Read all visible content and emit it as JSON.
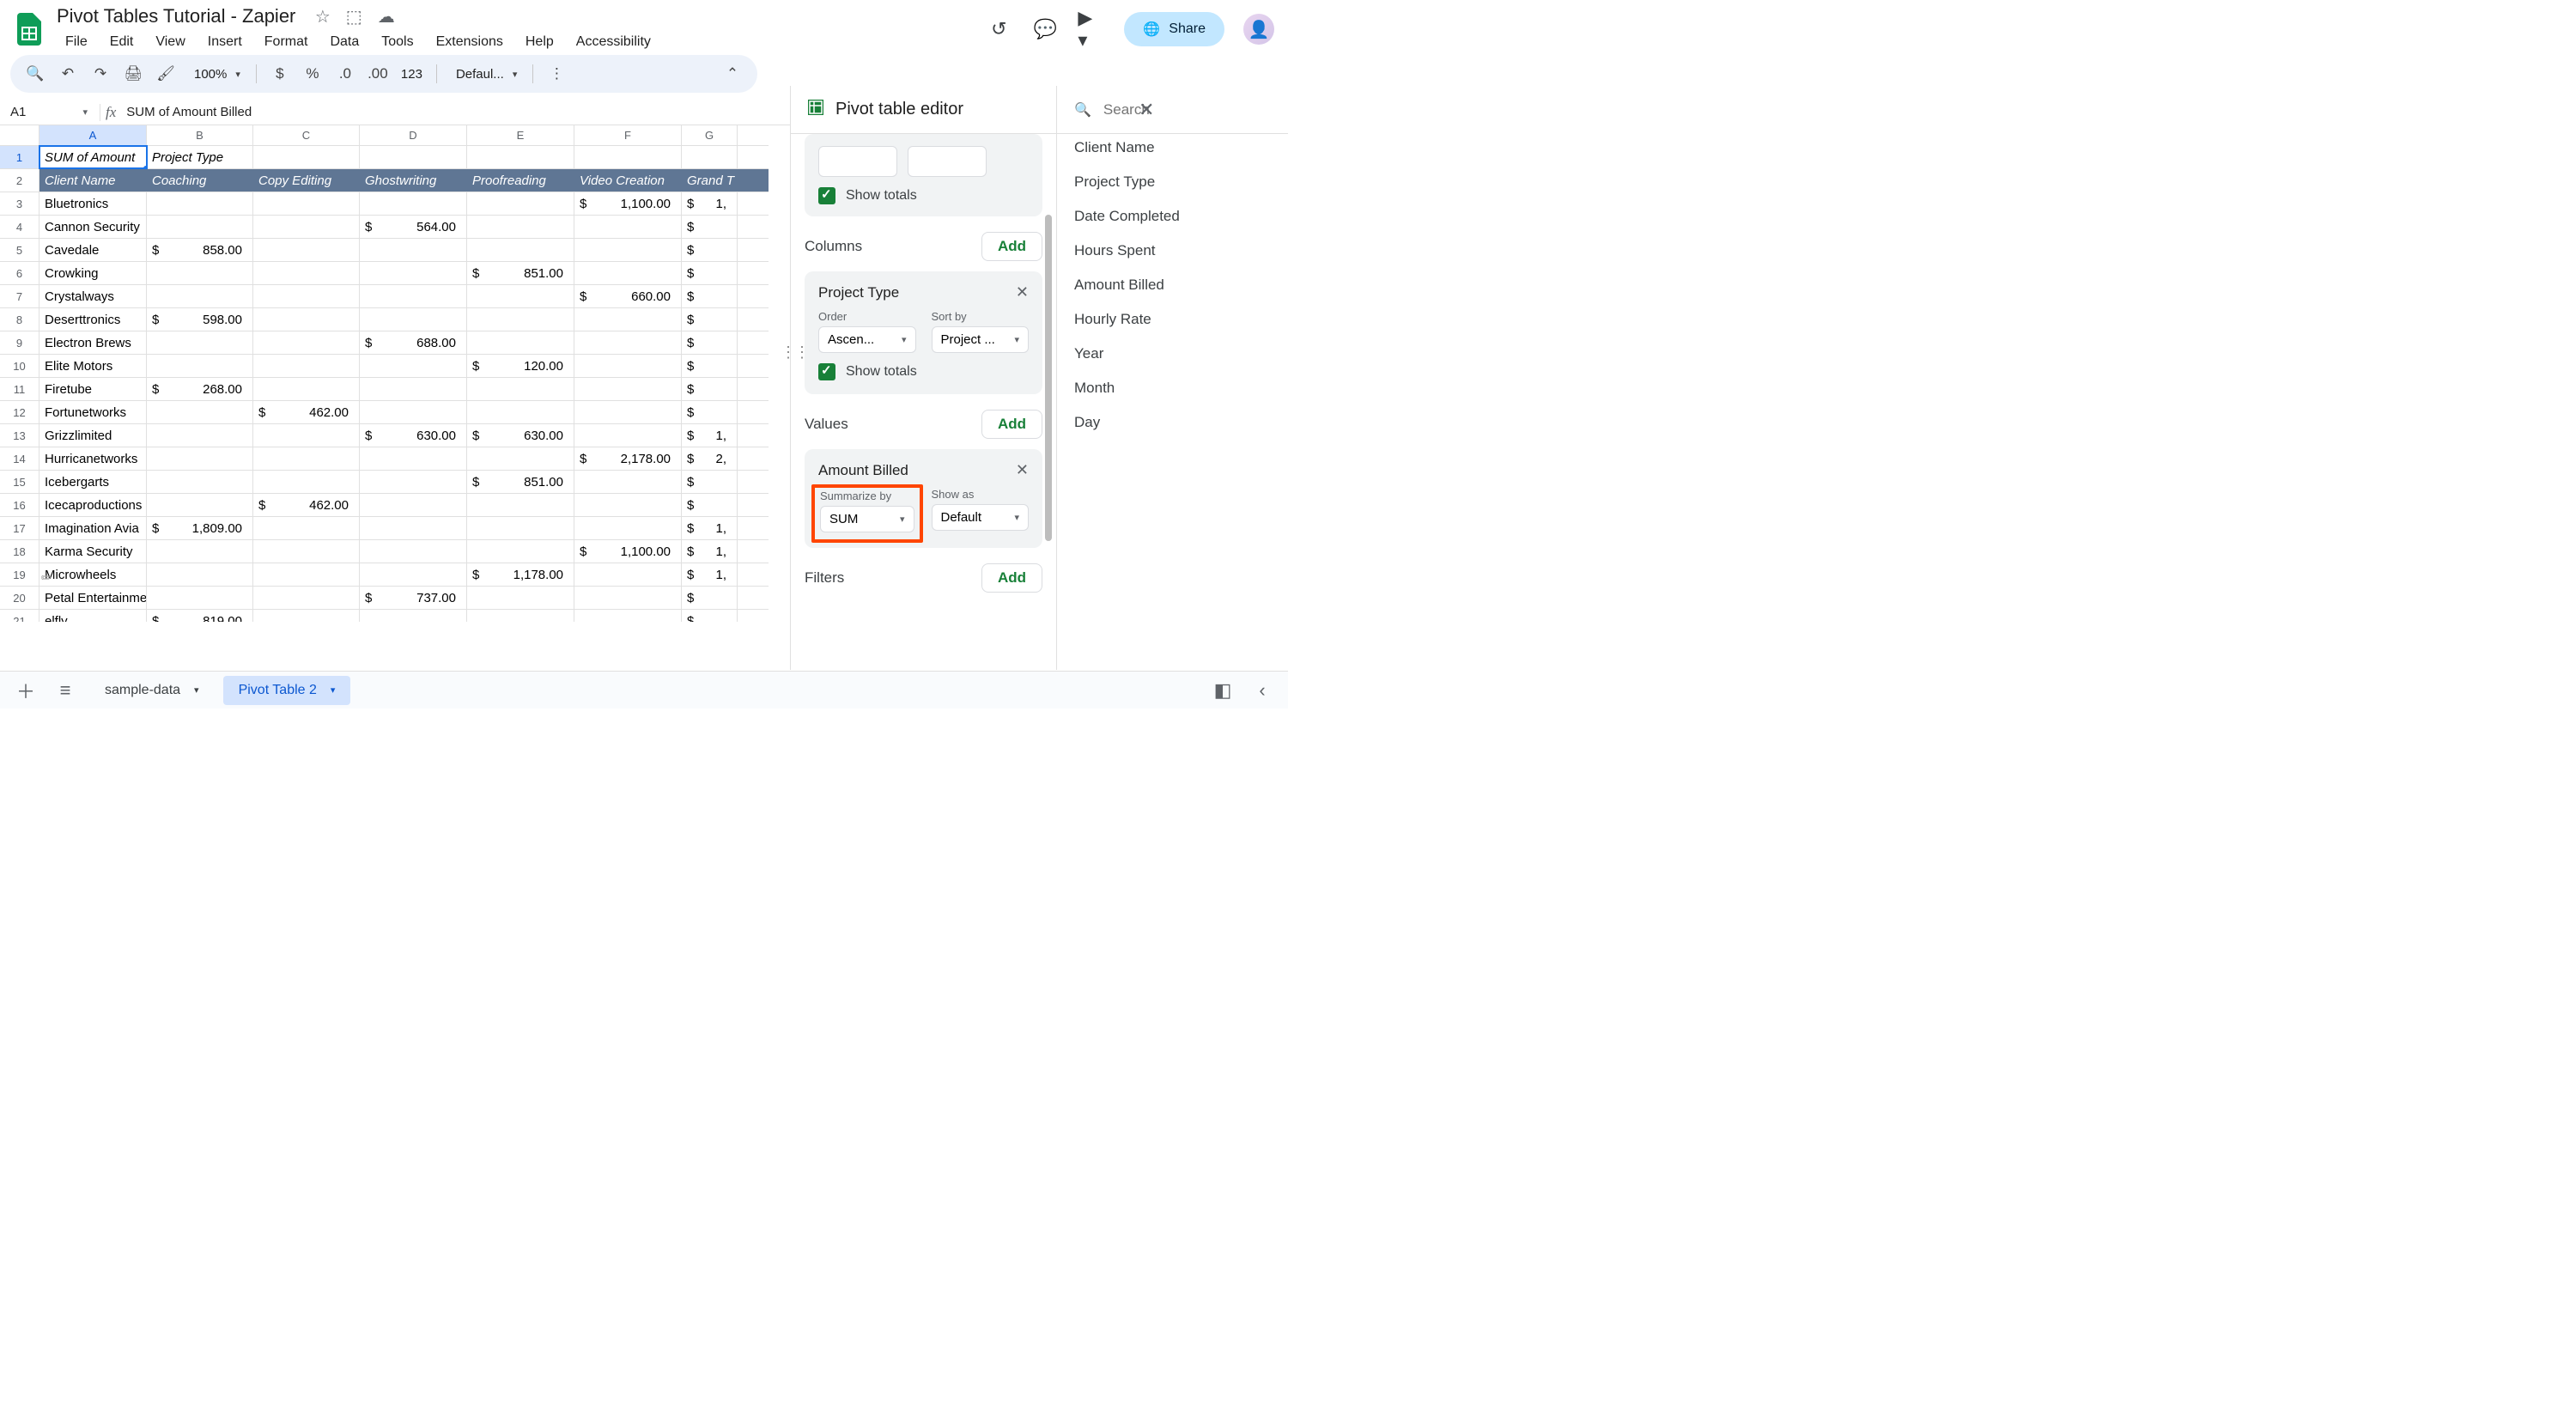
{
  "doc_title": "Pivot Tables Tutorial - Zapier",
  "menus": [
    "File",
    "Edit",
    "View",
    "Insert",
    "Format",
    "Data",
    "Tools",
    "Extensions",
    "Help",
    "Accessibility"
  ],
  "share_label": "Share",
  "toolbar": {
    "zoom": "100%",
    "number_format": "123",
    "font": "Defaul..."
  },
  "namebox": "A1",
  "formula": "SUM of  Amount Billed",
  "columns": [
    "A",
    "B",
    "C",
    "D",
    "E",
    "F",
    "G"
  ],
  "row1": {
    "A": "SUM of  Amount",
    "B": "Project Type"
  },
  "row2": [
    "Client Name",
    "Coaching",
    "Copy Editing",
    "Ghostwriting",
    "Proofreading",
    "Video Creation",
    "Grand T"
  ],
  "data_rows": [
    {
      "n": 3,
      "name": "Bluetronics",
      "F": "1,100.00",
      "G": "1,"
    },
    {
      "n": 4,
      "name": "Cannon Security",
      "D": "564.00"
    },
    {
      "n": 5,
      "name": "Cavedale",
      "B": "858.00"
    },
    {
      "n": 6,
      "name": "Crowking",
      "E": "851.00"
    },
    {
      "n": 7,
      "name": "Crystalways",
      "F": "660.00"
    },
    {
      "n": 8,
      "name": "Deserttronics",
      "B": "598.00"
    },
    {
      "n": 9,
      "name": "Electron Brews",
      "D": "688.00"
    },
    {
      "n": 10,
      "name": "Elite Motors",
      "E": "120.00"
    },
    {
      "n": 11,
      "name": "Firetube",
      "B": "268.00"
    },
    {
      "n": 12,
      "name": "Fortunetworks",
      "C": "462.00"
    },
    {
      "n": 13,
      "name": "Grizzlimited",
      "D": "630.00",
      "E": "630.00",
      "G": "1,"
    },
    {
      "n": 14,
      "name": "Hurricanetworks",
      "F": "2,178.00",
      "G": "2,"
    },
    {
      "n": 15,
      "name": "Icebergarts",
      "E": "851.00"
    },
    {
      "n": 16,
      "name": "Icecaproductions",
      "C": "462.00"
    },
    {
      "n": 17,
      "name": "Imagination Avia",
      "B": "1,809.00",
      "G": "1,"
    },
    {
      "n": 18,
      "name": "Karma Security",
      "F": "1,100.00",
      "G": "1,"
    },
    {
      "n": 19,
      "name": "Microwheels",
      "E": "1,178.00",
      "G": "1,"
    },
    {
      "n": 20,
      "name": "Petal Entertainment",
      "D": "737.00"
    },
    {
      "n": 21,
      "name": "elfly",
      "B": "819.00"
    }
  ],
  "editor": {
    "title": "Pivot table editor",
    "show_totals": "Show totals",
    "columns_label": "Columns",
    "values_label": "Values",
    "filters_label": "Filters",
    "add_label": "Add",
    "project_type": {
      "title": "Project Type",
      "order_label": "Order",
      "order_value": "Ascen...",
      "sort_label": "Sort by",
      "sort_value": "Project ..."
    },
    "amount_billed": {
      "title": "Amount Billed",
      "summarize_label": "Summarize by",
      "summarize_value": "SUM",
      "showas_label": "Show as",
      "showas_value": "Default"
    },
    "search_placeholder": "Search",
    "fields": [
      "Client Name",
      "Project Type",
      "Date Completed",
      "Hours Spent",
      "Amount Billed",
      "Hourly Rate",
      "Year",
      "Month",
      "Day"
    ]
  },
  "tabs": {
    "sheet1": "sample-data",
    "sheet2": "Pivot Table 2"
  }
}
